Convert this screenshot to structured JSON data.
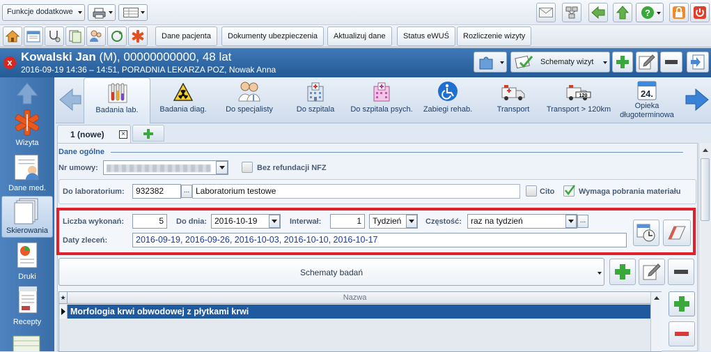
{
  "toolbar": {
    "funkcje": "Funkcje dodatkowe",
    "buttons": [
      "Dane pacjenta",
      "Dokumenty ubezpieczenia",
      "Aktualizuj dane",
      "Status eWUŚ",
      "Rozliczenie wizyty"
    ]
  },
  "patient": {
    "name": "Kowalski Jan",
    "details": " (M), 00000000000, 48 lat",
    "visit": "2016-09-19 14:36 – 14:51, PORADNIA LEKARZA POZ, Nowak Anna",
    "schematy": "Schematy wizyt"
  },
  "sidebar": {
    "items": [
      "Wizyta",
      "Dane med.",
      "Skierowania",
      "Druki",
      "Recepty"
    ]
  },
  "categories": [
    {
      "label": "Badania lab."
    },
    {
      "label": "Badania diag."
    },
    {
      "label": "Do specjalisty"
    },
    {
      "label": "Do szpitala"
    },
    {
      "label": "Do szpitala psych."
    },
    {
      "label": "Zabiegi rehab."
    },
    {
      "label": "Transport"
    },
    {
      "label": "Transport > 120km"
    },
    {
      "label": "Opieka",
      "label2": "długoterminowa"
    }
  ],
  "subtab": {
    "label": "1 (nowe)"
  },
  "form": {
    "section": "Dane ogólne",
    "nr_umowy_label": "Nr umowy:",
    "bez_refundacji": "Bez refundacji NFZ",
    "do_lab_label": "Do laboratorium:",
    "lab_code": "932382",
    "lab_name": "Laboratorium testowe",
    "cito": "Cito",
    "wymaga": "Wymaga pobrania materiału",
    "liczba_label": "Liczba wykonań:",
    "liczba": "5",
    "do_dnia_label": "Do dnia:",
    "do_dnia": "2016-10-19",
    "interwal_label": "Interwał:",
    "interwal": "1",
    "interwal_unit": "Tydzień",
    "czestosc_label": "Częstość:",
    "czestosc": "raz na tydzień",
    "daty_label": "Daty zleceń:",
    "daty": "2016-09-19, 2016-09-26, 2016-10-03, 2016-10-10, 2016-10-17",
    "ellipsis": "...",
    "schematy_badan": "Schematy badań"
  },
  "grid": {
    "header": "Nazwa",
    "rows": [
      "Morfologia krwi obwodowej z płytkami krwi"
    ]
  },
  "colors": {
    "header_blue": "#2e66a6",
    "highlight_red": "#e0202a",
    "row_selected": "#1f5aa0"
  }
}
